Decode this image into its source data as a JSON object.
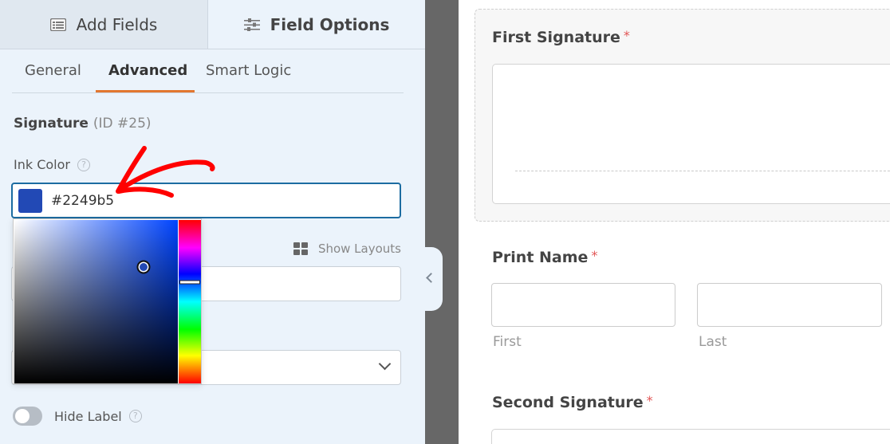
{
  "sidebar": {
    "top_tabs": [
      {
        "label": "Add Fields",
        "icon": "list-icon",
        "active": false
      },
      {
        "label": "Field Options",
        "icon": "sliders-icon",
        "active": true
      }
    ],
    "sub_tabs": [
      {
        "label": "General",
        "active": false
      },
      {
        "label": "Advanced",
        "active": true
      },
      {
        "label": "Smart Logic",
        "active": false
      }
    ],
    "field": {
      "name": "Signature",
      "id_text": "(ID #25)"
    },
    "ink_color": {
      "label": "Ink Color",
      "help": "?",
      "value": "#2249b5"
    },
    "color_picker": {
      "hue_position": 0.38,
      "saturation": 0.79,
      "brightness": 0.71
    },
    "show_layouts": "Show Layouts",
    "hide_label": {
      "label": "Hide Label",
      "help": "?",
      "enabled": false
    },
    "collapse_icon": "chevron-left-icon"
  },
  "colors": {
    "accent": "#e27730",
    "focus": "#1c6ca1",
    "required": "#e25555",
    "annotation": "#ff0000"
  },
  "preview": {
    "first_signature": {
      "label": "First Signature",
      "required": "*"
    },
    "print_name": {
      "label": "Print Name",
      "required": "*",
      "sublabels": [
        "First",
        "Last"
      ]
    },
    "second_signature": {
      "label": "Second Signature",
      "required": "*"
    }
  }
}
